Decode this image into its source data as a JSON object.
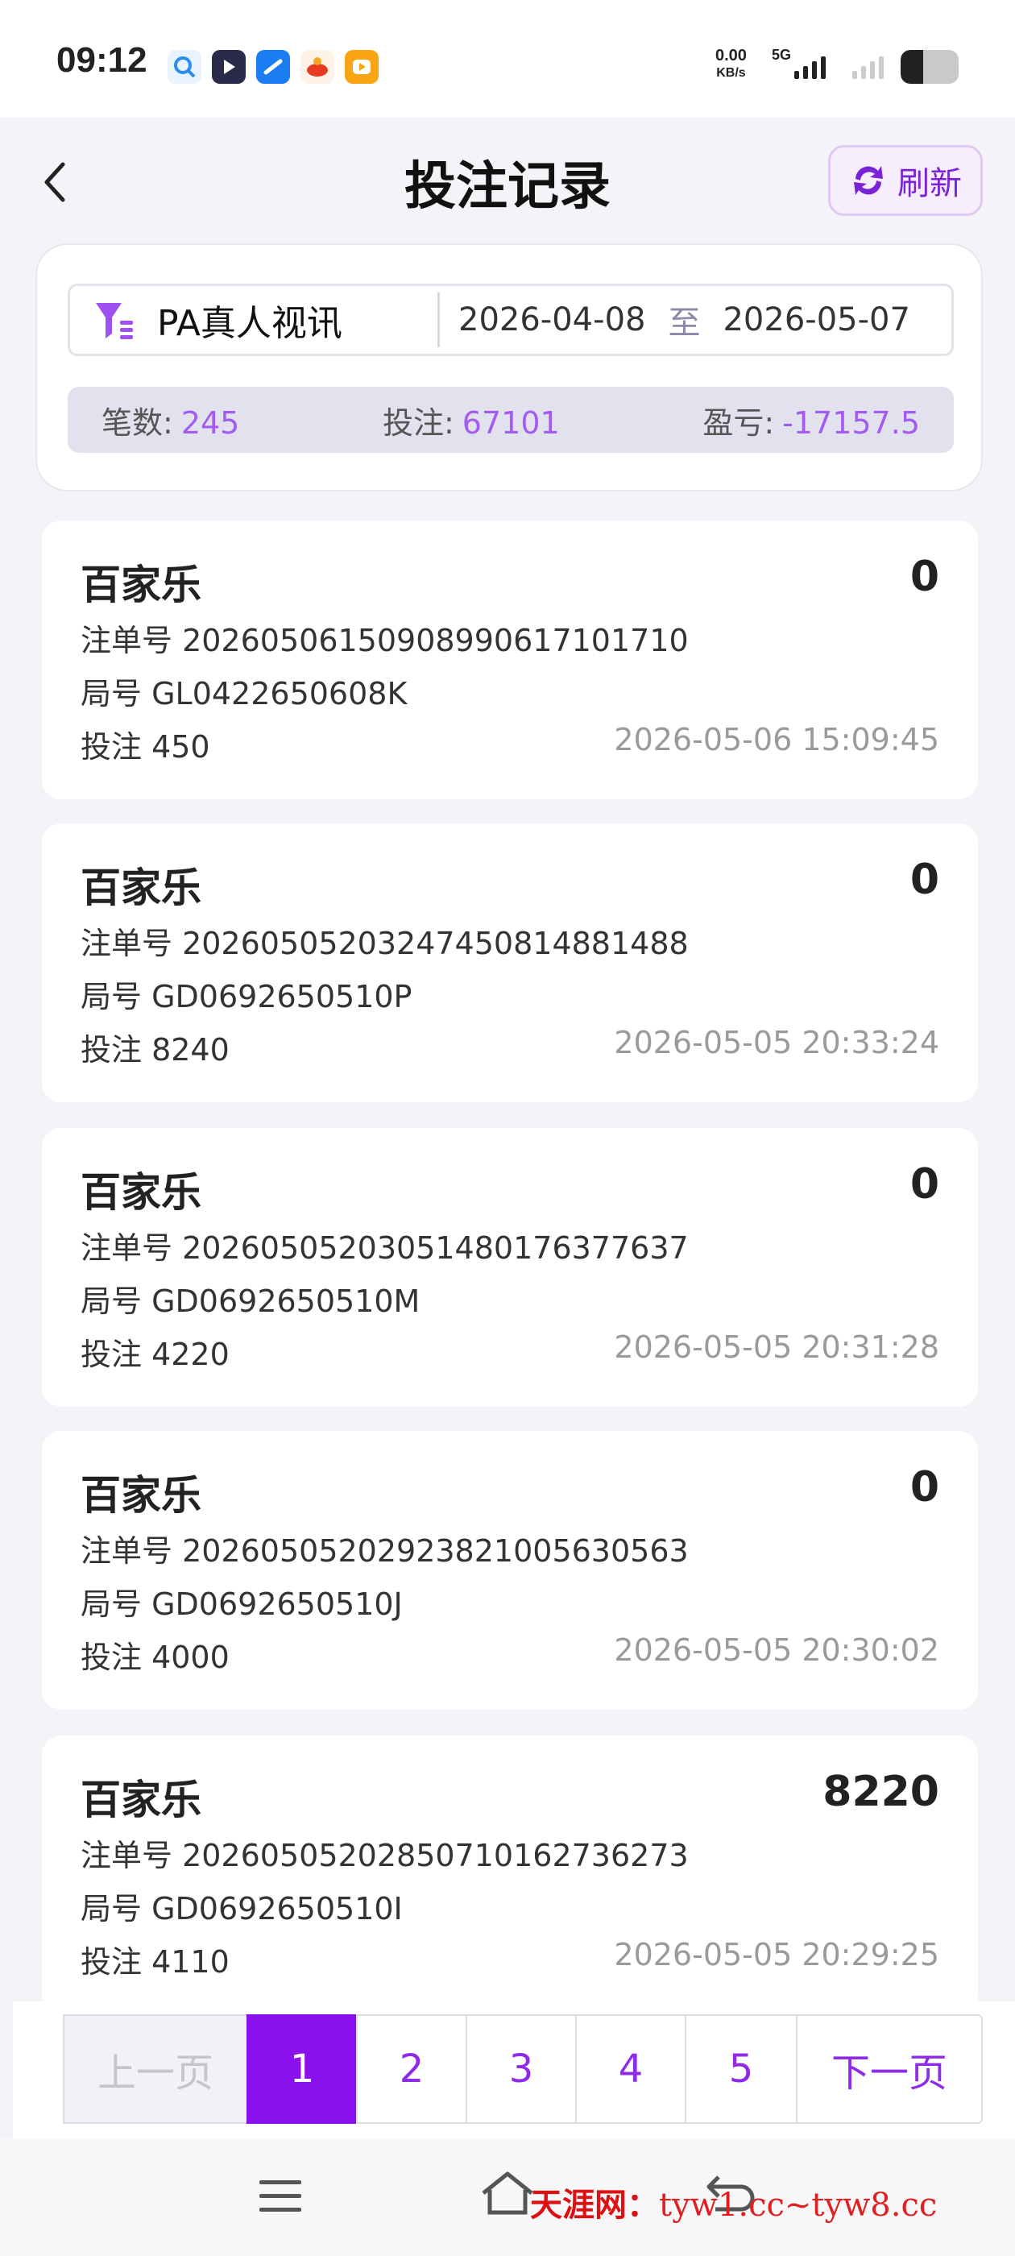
{
  "status_bar": {
    "time": "09:12",
    "net_speed_value": "0.00",
    "net_speed_unit": "KB/s",
    "network_type": "5G"
  },
  "header": {
    "title": "投注记录",
    "refresh_label": "刷新"
  },
  "filter": {
    "venue": "PA真人视讯",
    "date_from": "2026-04-08",
    "date_sep": "至",
    "date_to": "2026-05-07"
  },
  "summary": {
    "count_label": "笔数:",
    "count_value": "245",
    "bet_label": "投注:",
    "bet_value": "67101",
    "profit_label": "盈亏:",
    "profit_value": "-17157.5"
  },
  "records": [
    {
      "game": "百家乐",
      "result": "0",
      "order": "注单号 20260506150908990617101710",
      "round": "局号 GL0422650608K",
      "bet": "投注 450",
      "time": "2026-05-06 15:09:45"
    },
    {
      "game": "百家乐",
      "result": "0",
      "order": "注单号 20260505203247450814881488",
      "round": "局号 GD0692650510P",
      "bet": "投注 8240",
      "time": "2026-05-05 20:33:24"
    },
    {
      "game": "百家乐",
      "result": "0",
      "order": "注单号 20260505203051480176377637",
      "round": "局号 GD0692650510M",
      "bet": "投注 4220",
      "time": "2026-05-05 20:31:28"
    },
    {
      "game": "百家乐",
      "result": "0",
      "order": "注单号 20260505202923821005630563",
      "round": "局号 GD0692650510J",
      "bet": "投注 4000",
      "time": "2026-05-05 20:30:02"
    },
    {
      "game": "百家乐",
      "result": "8220",
      "order": "注单号 20260505202850710162736273",
      "round": "局号 GD0692650510I",
      "bet": "投注 4110",
      "time": "2026-05-05 20:29:25"
    }
  ],
  "pagination": {
    "prev": "上一页",
    "pages": [
      "1",
      "2",
      "3",
      "4",
      "5"
    ],
    "next": "下一页",
    "current": "1"
  },
  "watermark": {
    "site": "天涯网：",
    "url": "tyw1.cc~tyw8.cc"
  },
  "colors": {
    "accent": "#8b10ee",
    "value_purple": "#a45cf0"
  }
}
